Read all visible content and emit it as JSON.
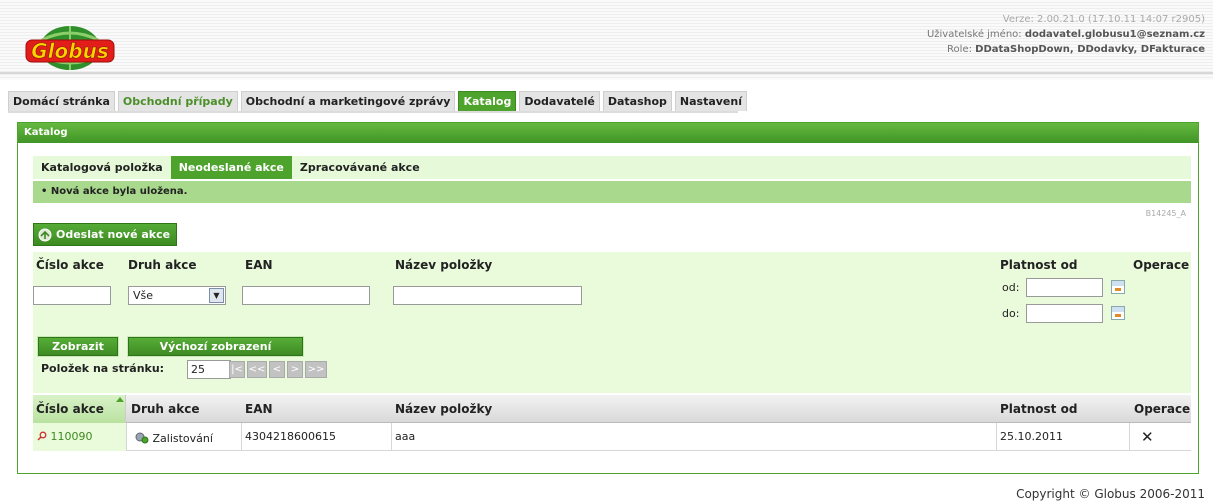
{
  "header": {
    "logo_text": "Globus",
    "version": "Verze: 2.00.21.0 (17.10.11 14:07 r2905)",
    "user_label": "Uživatelské jméno:",
    "user_value": "dodavatel.globusu1@seznam.cz",
    "role_label": "Role:",
    "role_value": "DDataShopDown, DDodavky, DFakturace"
  },
  "nav": {
    "tabs": [
      {
        "label": "Domácí stránka"
      },
      {
        "label": "Obchodní případy"
      },
      {
        "label": "Obchodní a marketingové zprávy"
      },
      {
        "label": "Katalog"
      },
      {
        "label": "Dodavatelé"
      },
      {
        "label": "Datashop"
      },
      {
        "label": "Nastavení"
      }
    ]
  },
  "panel": {
    "title": "Katalog",
    "subtabs": [
      {
        "label": "Katalogová položka"
      },
      {
        "label": "Neodeslané akce"
      },
      {
        "label": "Zpracovávané akce"
      }
    ],
    "message": "• Nová akce byla uložena.",
    "code": "B14245_A",
    "send_button": "Odeslat nové akce"
  },
  "filter": {
    "labels": {
      "cislo": "Číslo akce",
      "druh": "Druh akce",
      "ean": "EAN",
      "nazev": "Název položky",
      "platnost": "Platnost od",
      "operace": "Operace"
    },
    "druh_value": "Vše",
    "od_label": "od:",
    "do_label": "do:",
    "show_button": "Zobrazit",
    "default_button": "Výchozí zobrazení",
    "per_page_label": "Položek na stránku:",
    "per_page_value": "25",
    "pager": [
      "|<",
      "<<",
      "<",
      ">",
      ">>"
    ]
  },
  "table": {
    "headers": {
      "cislo": "Číslo akce",
      "druh": "Druh akce",
      "ean": "EAN",
      "nazev": "Název položky",
      "platnost": "Platnost od",
      "operace": "Operace"
    },
    "rows": [
      {
        "cislo": "110090",
        "druh": "Zalistování",
        "ean": "4304218600615",
        "nazev": "aaa",
        "platnost": "25.10.2011",
        "operace": "✕"
      }
    ]
  },
  "footer": {
    "copyright": "Copyright © Globus 2006-2011"
  },
  "colors": {
    "accent": "#4ea32d",
    "light_green": "#eafbdc"
  }
}
